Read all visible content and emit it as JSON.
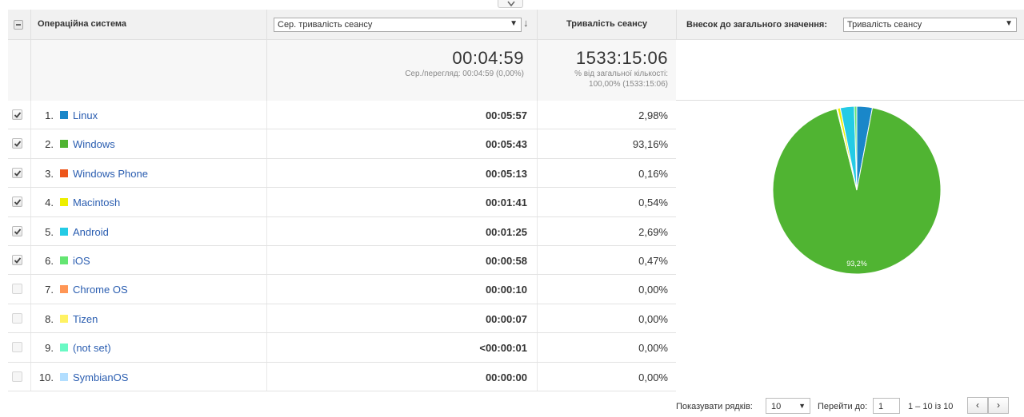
{
  "header": {
    "os_col": "Операційна система",
    "metric_select": "Сер. тривалість сеансу",
    "duration_col": "Тривалість сеансу",
    "contrib_label": "Внесок до загального значення:",
    "contrib_select": "Тривалість сеансу"
  },
  "summary": {
    "avg_value": "00:04:59",
    "avg_note": "Сер./перегляд: 00:04:59 (0,00%)",
    "total_value": "1533:15:06",
    "total_note_1": "% від загальної кількості:",
    "total_note_2": "100,00% (1533:15:06)"
  },
  "rows": [
    {
      "idx": "1.",
      "name": "Linux",
      "time": "00:05:57",
      "pct": "2,98%",
      "checked": true,
      "color": "#1a87c9"
    },
    {
      "idx": "2.",
      "name": "Windows",
      "time": "00:05:43",
      "pct": "93,16%",
      "checked": true,
      "color": "#50b432"
    },
    {
      "idx": "3.",
      "name": "Windows Phone",
      "time": "00:05:13",
      "pct": "0,16%",
      "checked": true,
      "color": "#ed561b"
    },
    {
      "idx": "4.",
      "name": "Macintosh",
      "time": "00:01:41",
      "pct": "0,54%",
      "checked": true,
      "color": "#edef00"
    },
    {
      "idx": "5.",
      "name": "Android",
      "time": "00:01:25",
      "pct": "2,69%",
      "checked": true,
      "color": "#24cbe5"
    },
    {
      "idx": "6.",
      "name": "iOS",
      "time": "00:00:58",
      "pct": "0,47%",
      "checked": true,
      "color": "#64e572"
    },
    {
      "idx": "7.",
      "name": "Chrome OS",
      "time": "00:00:10",
      "pct": "0,00%",
      "checked": false,
      "color": "#ff9655"
    },
    {
      "idx": "8.",
      "name": "Tizen",
      "time": "00:00:07",
      "pct": "0,00%",
      "checked": false,
      "color": "#fff263"
    },
    {
      "idx": "9.",
      "name": "(not set)",
      "time": "<00:00:01",
      "pct": "0,00%",
      "checked": false,
      "color": "#6af9c4"
    },
    {
      "idx": "10.",
      "name": "SymbianOS",
      "time": "00:00:00",
      "pct": "0,00%",
      "checked": false,
      "color": "#b2deff"
    }
  ],
  "pie": {
    "label": "93,2%",
    "slices": [
      {
        "name": "Linux",
        "value": 2.98,
        "color": "#1a87c9"
      },
      {
        "name": "Windows",
        "value": 93.16,
        "color": "#50b432"
      },
      {
        "name": "Windows Phone",
        "value": 0.16,
        "color": "#ed561b"
      },
      {
        "name": "Macintosh",
        "value": 0.54,
        "color": "#edef00"
      },
      {
        "name": "Android",
        "value": 2.69,
        "color": "#24cbe5"
      },
      {
        "name": "iOS",
        "value": 0.47,
        "color": "#64e572"
      }
    ]
  },
  "pager": {
    "rows_label": "Показувати рядків:",
    "rows_value": "10",
    "goto_label": "Перейти до:",
    "goto_value": "1",
    "range": "1 – 10 із 10",
    "prev": "‹",
    "next": "›"
  }
}
